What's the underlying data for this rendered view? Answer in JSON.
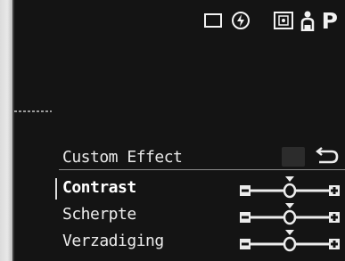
{
  "status_bar": {
    "icons": [
      "single-shot-icon",
      "flash-off-icon",
      "metering-icon",
      "person-icon"
    ],
    "mode": "P"
  },
  "menu": {
    "title": "Custom Effect",
    "back_icon": "return-arrow-icon",
    "items": [
      {
        "label": "Contrast",
        "selected": true,
        "level": 0
      },
      {
        "label": "Scherpte",
        "selected": false,
        "level": 0
      },
      {
        "label": "Verzadiging",
        "selected": false,
        "level": 0
      }
    ],
    "slider_range": [
      -2,
      2
    ]
  },
  "colors": {
    "screen_background": "#141414",
    "text": "#ececec"
  }
}
